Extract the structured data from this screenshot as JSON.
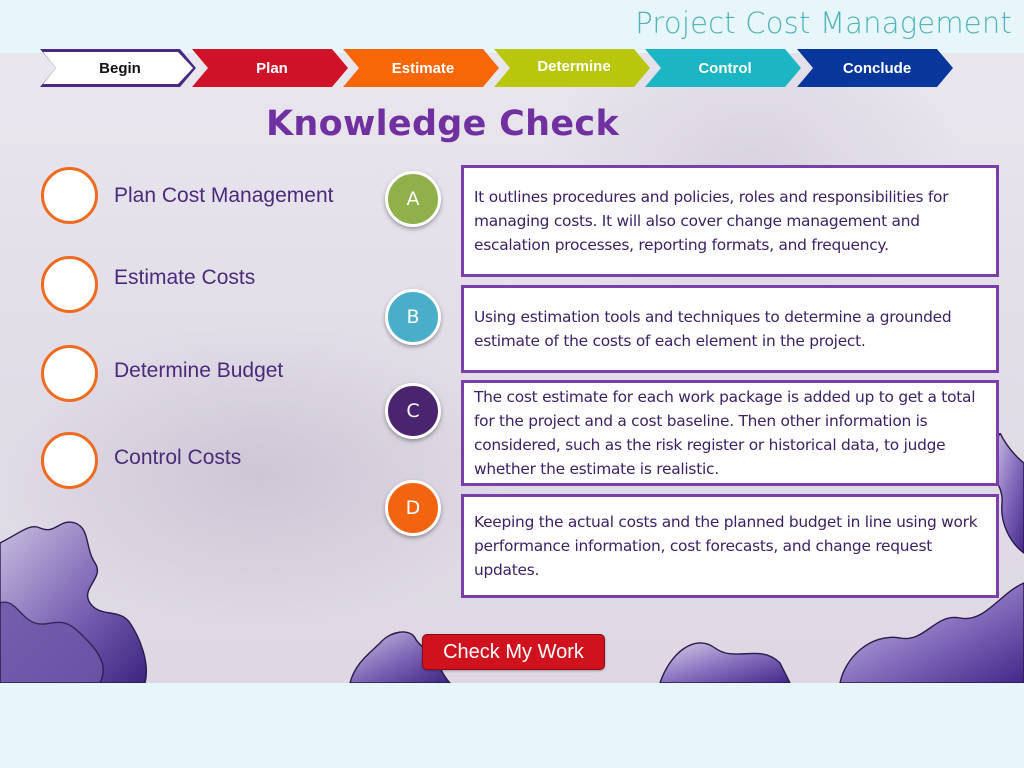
{
  "header": {
    "title": "Project Cost Management"
  },
  "nav": {
    "steps": [
      {
        "label": "Begin",
        "color": "#ffffff",
        "border": "#4a2a80"
      },
      {
        "label": "Plan",
        "color": "#cf1227"
      },
      {
        "label": "Estimate",
        "color": "#f76707"
      },
      {
        "label": "Determine",
        "color": "#b9c70c"
      },
      {
        "label": "Control",
        "color": "#1bb5c3"
      },
      {
        "label": "Conclude",
        "color": "#08369b"
      }
    ]
  },
  "main": {
    "heading": "Knowledge Check",
    "terms": [
      {
        "label": "Plan Cost Management"
      },
      {
        "label": "Estimate Costs"
      },
      {
        "label": "Determine Budget"
      },
      {
        "label": "Control Costs"
      }
    ],
    "answers": [
      {
        "letter": "A",
        "color": "#8fb04a",
        "definition": "It outlines procedures and policies, roles and responsibilities for managing costs. It will also cover change management and escalation processes, reporting formats, and frequency."
      },
      {
        "letter": "B",
        "color": "#4aaecb",
        "definition": "Using estimation tools and techniques to determine a grounded estimate of the costs of each element in the project."
      },
      {
        "letter": "C",
        "color": "#4b2470",
        "definition": "The cost estimate for each work package is added up to get a total for the project and a cost baseline. Then other information is considered, such as the risk register or historical data, to judge whether the estimate is realistic."
      },
      {
        "letter": "D",
        "color": "#f26410",
        "definition": "Keeping the actual costs and the planned budget in line using work performance information, cost forecasts, and change request updates."
      }
    ],
    "check_button": "Check My Work"
  }
}
